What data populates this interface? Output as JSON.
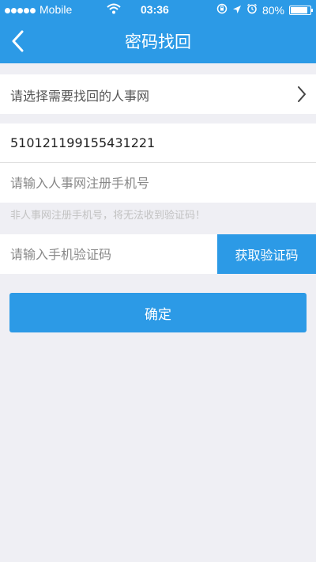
{
  "status_bar": {
    "carrier": "Mobile",
    "time": "03:36",
    "battery": "80%"
  },
  "nav": {
    "title": "密码找回"
  },
  "form": {
    "target_select_label": "请选择需要找回的人事网",
    "id_value": "510121199155431221",
    "phone_placeholder": "请输入人事网注册手机号",
    "phone_hint": "非人事网注册手机号，将无法收到验证码！",
    "code_placeholder": "请输入手机验证码",
    "get_code_label": "获取验证码",
    "confirm_label": "确定"
  },
  "colors": {
    "accent": "#2c9ae6",
    "background": "#efeff4"
  },
  "icons": [
    "signal-dots-icon",
    "wifi-icon",
    "orientation-lock-icon",
    "location-arrow-icon",
    "alarm-icon",
    "battery-icon",
    "back-arrow-icon",
    "chevron-right-icon"
  ]
}
